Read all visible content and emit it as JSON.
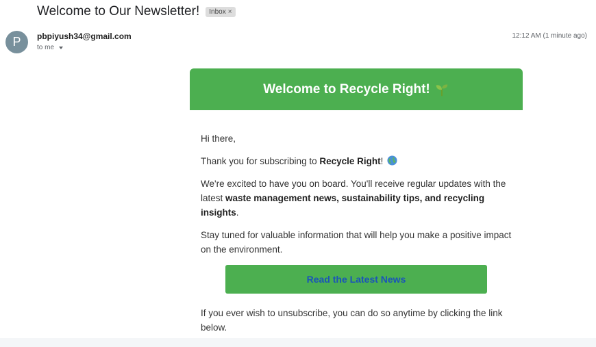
{
  "email": {
    "subject": "Welcome to Our Newsletter!",
    "label": "Inbox",
    "sender_initial": "P",
    "sender_email": "pbpiyush34@gmail.com",
    "recipient": "to me",
    "timestamp": "12:12 AM (1 minute ago)"
  },
  "newsletter": {
    "banner_title": "Welcome to Recycle Right!",
    "greeting": "Hi there,",
    "thanks_prefix": "Thank you for subscribing to ",
    "brand": "Recycle Right",
    "thanks_suffix": "!",
    "body_prefix": "We're excited to have you on board. You'll receive regular updates with the latest ",
    "body_bold": "waste management news, sustainability tips, and recycling insights",
    "body_suffix": ".",
    "stay_tuned": "Stay tuned for valuable information that will help you make a positive impact on the environment.",
    "cta_label": "Read the Latest News",
    "unsubscribe": "If you ever wish to unsubscribe, you can do so anytime by clicking the link below."
  },
  "colors": {
    "brand_green": "#4caf50",
    "cta_text": "#1a55b8",
    "avatar": "#78909c"
  },
  "icons": [
    "seedling-icon",
    "globe-icon",
    "close-icon",
    "chevron-down-icon"
  ]
}
